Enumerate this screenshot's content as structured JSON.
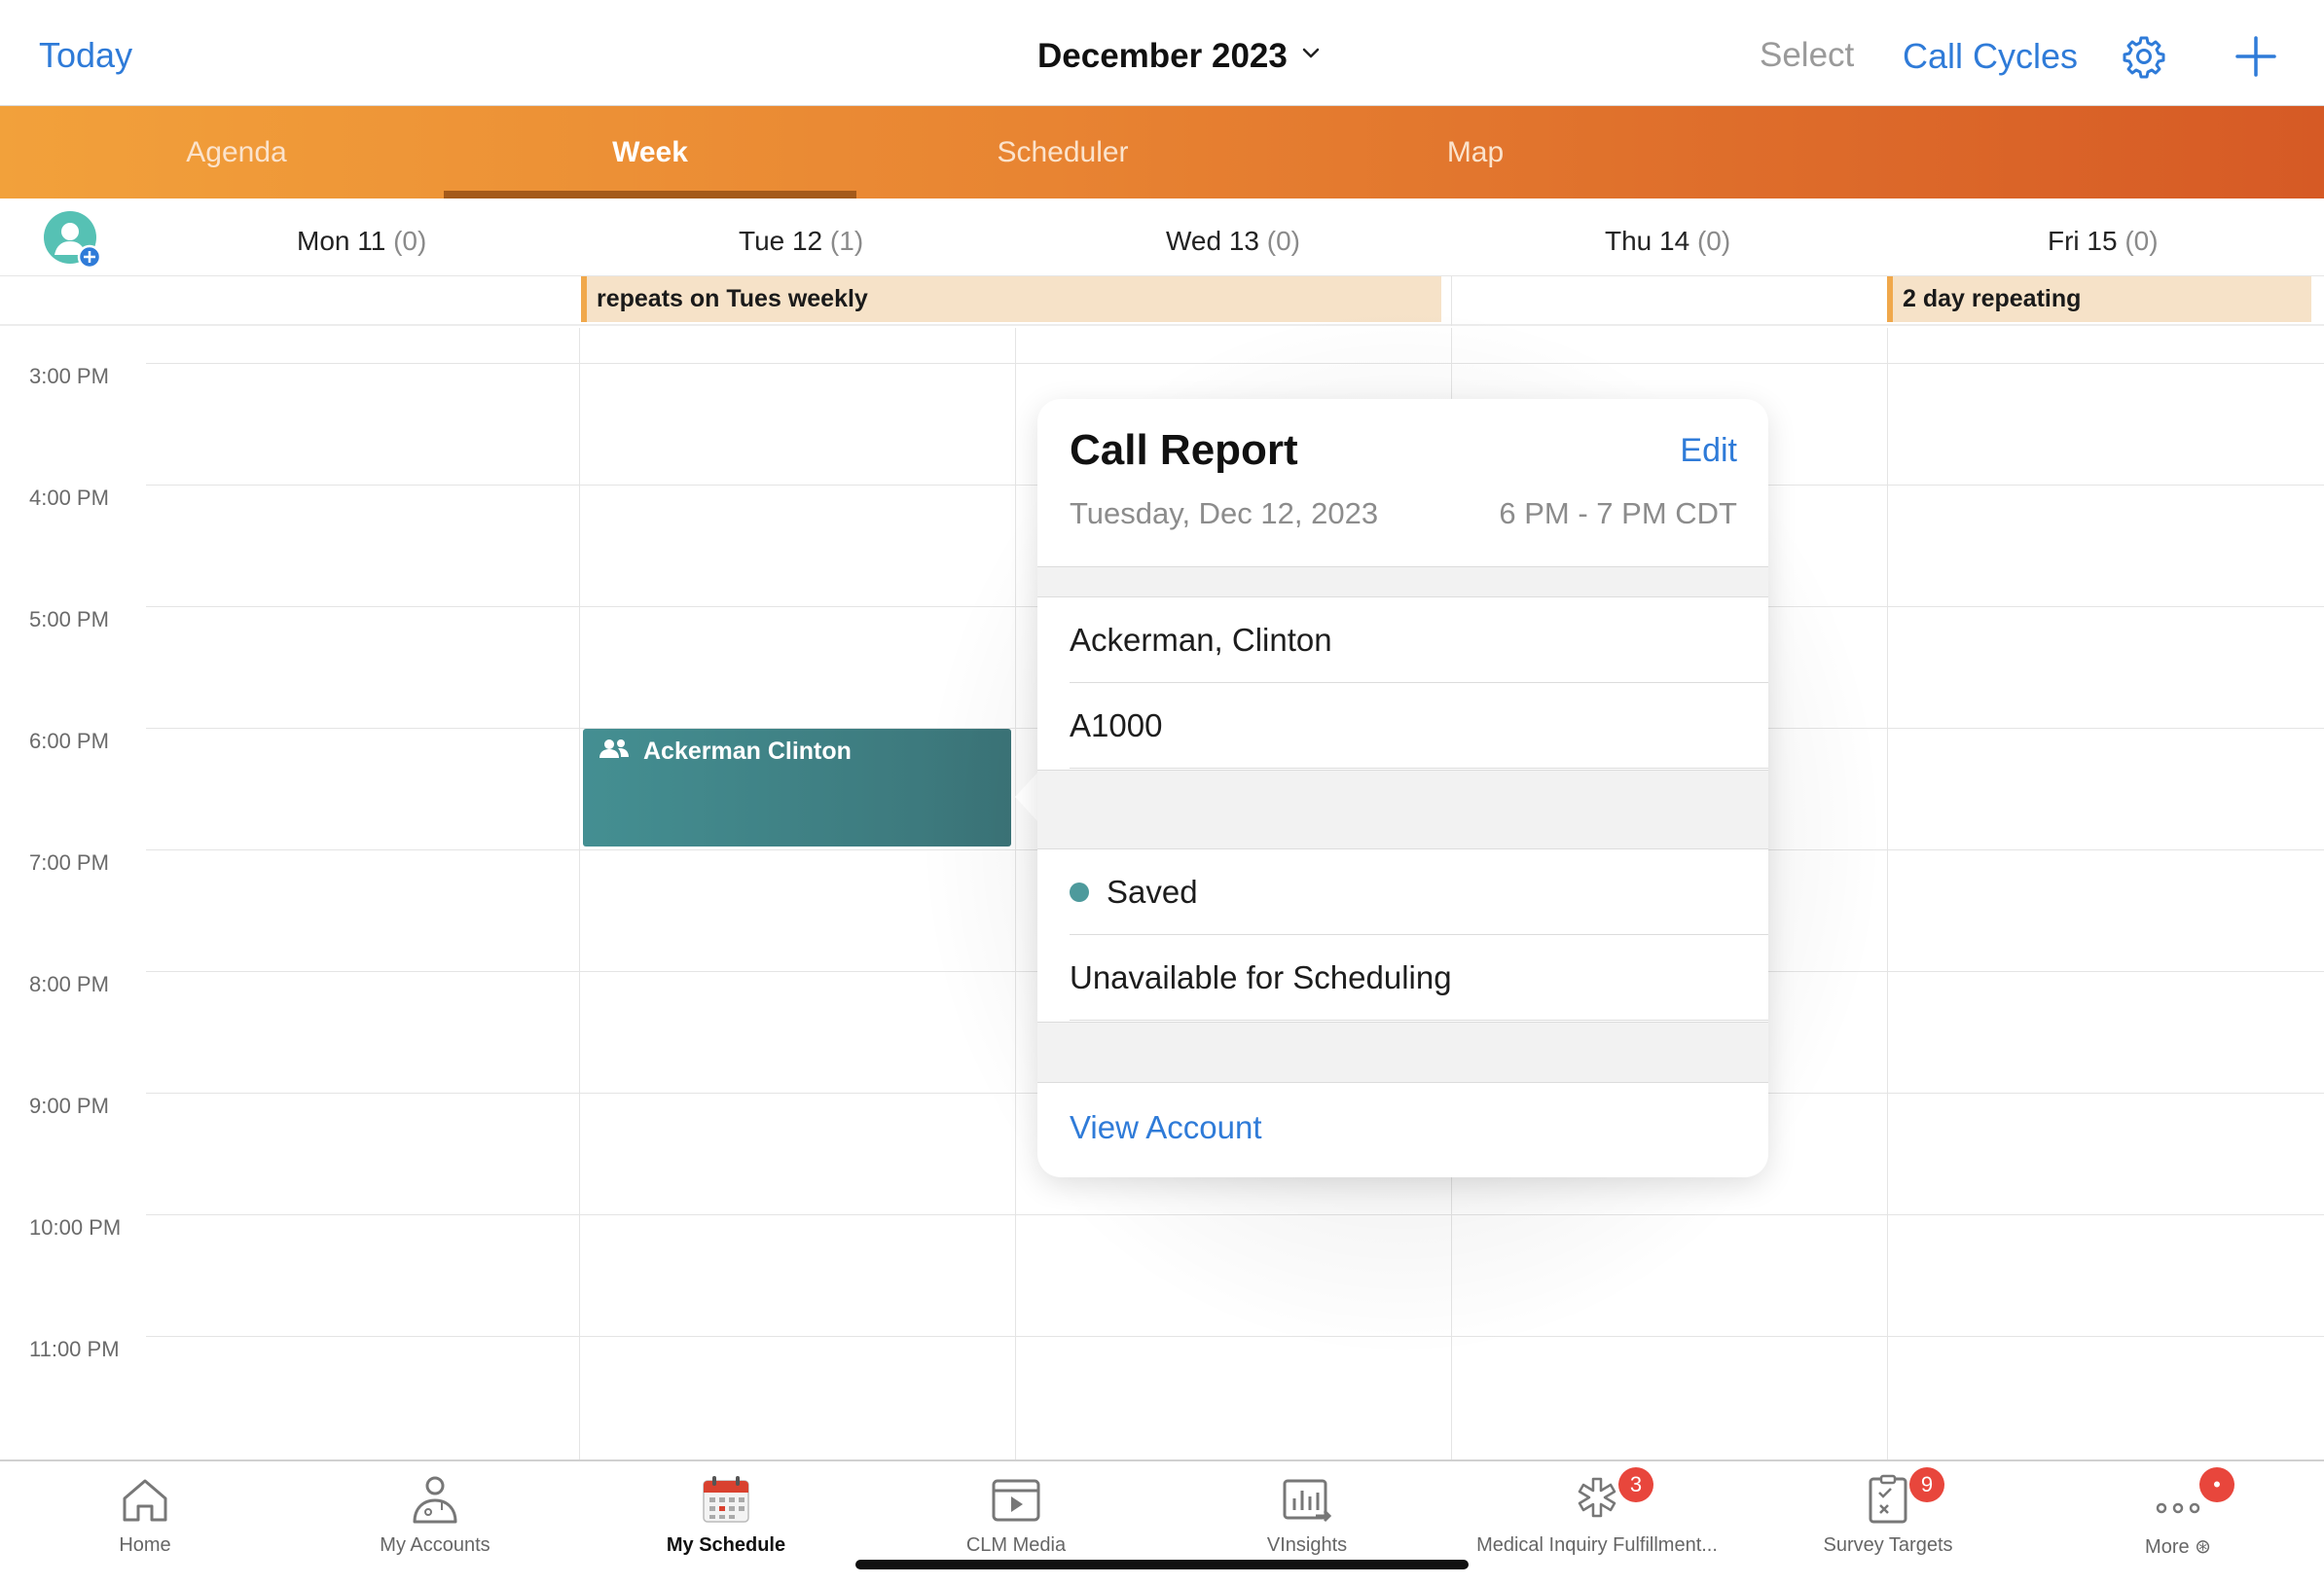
{
  "topnav": {
    "today": "Today",
    "month": "December 2023",
    "select": "Select",
    "call_cycles": "Call Cycles"
  },
  "tabs": [
    "Agenda",
    "Week",
    "Scheduler",
    "Map"
  ],
  "active_tab": "Week",
  "days": [
    {
      "name": "Mon 11",
      "count": "(0)"
    },
    {
      "name": "Tue 12",
      "count": "(1)"
    },
    {
      "name": "Wed 13",
      "count": "(0)"
    },
    {
      "name": "Thu 14",
      "count": "(0)"
    },
    {
      "name": "Fri 15",
      "count": "(0)"
    }
  ],
  "all_day_events": [
    "repeats on Tues weekly",
    "2 day repeating"
  ],
  "times": [
    "3:00 PM",
    "4:00 PM",
    "5:00 PM",
    "6:00 PM",
    "7:00 PM",
    "8:00 PM",
    "9:00 PM",
    "10:00 PM",
    "11:00 PM"
  ],
  "event": {
    "label": "Ackerman Clinton"
  },
  "popover": {
    "title": "Call Report",
    "edit": "Edit",
    "date": "Tuesday, Dec 12, 2023",
    "time": "6 PM - 7 PM CDT",
    "account_name": "Ackerman, Clinton",
    "account_id": "A1000",
    "status": "Saved",
    "availability": "Unavailable for Scheduling",
    "view_account": "View Account"
  },
  "bottom_tabs": [
    {
      "label": "Home"
    },
    {
      "label": "My Accounts"
    },
    {
      "label": "My Schedule"
    },
    {
      "label": "CLM Media"
    },
    {
      "label": "VInsights"
    },
    {
      "label": "Medical Inquiry Fulfillment...",
      "badge": "3"
    },
    {
      "label": "Survey Targets",
      "badge": "9"
    },
    {
      "label": "More ⊛",
      "badge": "•"
    }
  ],
  "active_bottom_tab": "My Schedule",
  "colors": {
    "accent_blue": "#2f7bd8",
    "orange_start": "#f2a13b",
    "orange_end": "#d65a25",
    "event_teal": "#3f8185",
    "allday_fill": "#f6e2c8",
    "badge_red": "#e8463c"
  }
}
